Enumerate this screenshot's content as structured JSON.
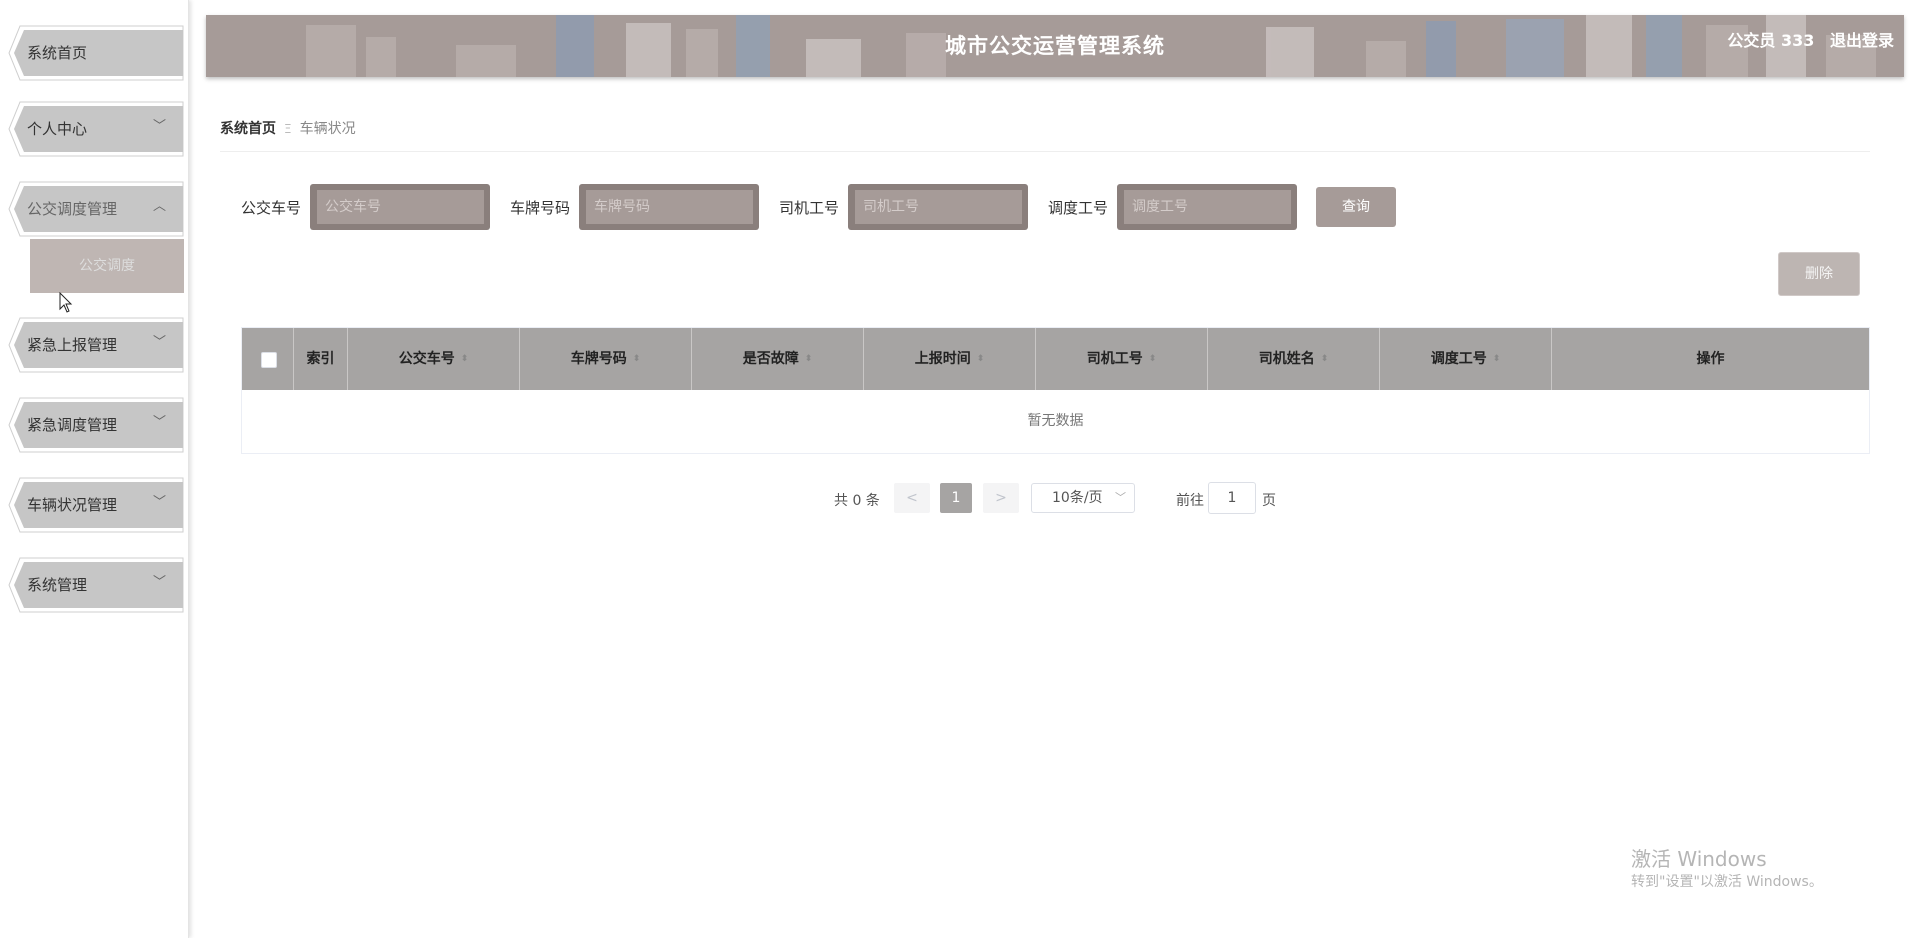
{
  "app": {
    "title": "城市公交运营管理系统",
    "user": "公交员 333",
    "logout": "退出登录"
  },
  "colors": {
    "accent": "#a69b98",
    "menu_bg": "#c6c6c6",
    "table_header": "#a6a4a3"
  },
  "sidebar": {
    "items": [
      {
        "label": "系统首页",
        "chevron": ""
      },
      {
        "label": "个人中心",
        "chevron": "﹀"
      },
      {
        "label": "公交调度管理",
        "chevron": "︿"
      },
      {
        "label": "紧急上报管理",
        "chevron": "﹀"
      },
      {
        "label": "紧急调度管理",
        "chevron": "﹀"
      },
      {
        "label": "车辆状况管理",
        "chevron": "﹀"
      },
      {
        "label": "系统管理",
        "chevron": "﹀"
      }
    ],
    "submenu": {
      "label": "公交调度"
    }
  },
  "breadcrumb": {
    "home": "系统首页",
    "separator": "Ξ",
    "current": "车辆状况"
  },
  "search": {
    "fields": [
      {
        "label": "公交车号",
        "placeholder": "公交车号"
      },
      {
        "label": "车牌号码",
        "placeholder": "车牌号码"
      },
      {
        "label": "司机工号",
        "placeholder": "司机工号"
      },
      {
        "label": "调度工号",
        "placeholder": "调度工号"
      }
    ],
    "query_button": "查询"
  },
  "actions": {
    "delete_button": "删除"
  },
  "table": {
    "columns": [
      "索引",
      "公交车号",
      "车牌号码",
      "是否故障",
      "上报时间",
      "司机工号",
      "司机姓名",
      "调度工号",
      "操作"
    ],
    "sort_icon": "⬍",
    "empty_text": "暂无数据"
  },
  "pagination": {
    "total": "共 0 条",
    "prev": "<",
    "page": "1",
    "next": ">",
    "page_size": "10条/页",
    "size_arrow": "﹀",
    "goto_label": "前往",
    "goto_value": "1",
    "page_suffix": "页"
  },
  "watermark": {
    "line1": "激活 Windows",
    "line2": "转到\"设置\"以激活 Windows。"
  }
}
